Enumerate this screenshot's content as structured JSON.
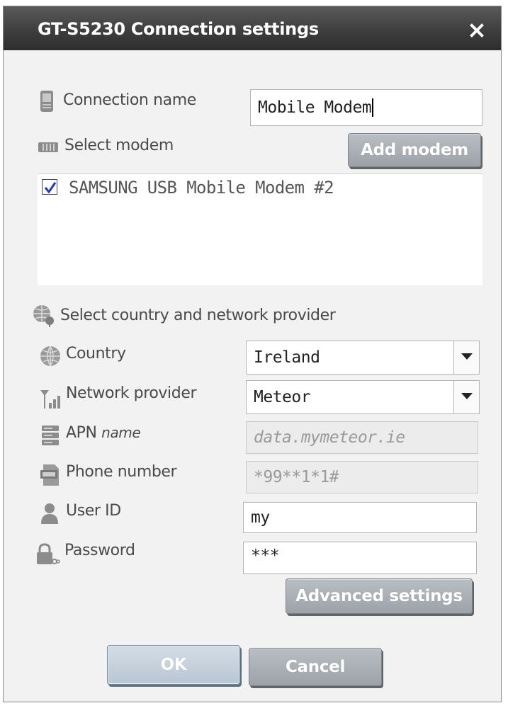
{
  "dialog": {
    "title": "GT-S5230 Connection settings",
    "close_label": "×"
  },
  "connection": {
    "name_label": "Connection name",
    "name_value": "Mobile Modem"
  },
  "modem": {
    "select_label": "Select modem",
    "add_button": "Add modem",
    "items": [
      {
        "label": "SAMSUNG USB Mobile Modem #2",
        "checked": true
      }
    ]
  },
  "network": {
    "section_label": "Select country and network provider",
    "country_label": "Country",
    "country_value": "Ireland",
    "provider_label": "Network provider",
    "provider_value": "Meteor",
    "apn_label_main": "APN",
    "apn_label_sub": "name",
    "apn_value": "data.mymeteor.ie",
    "phone_label": "Phone number",
    "phone_value": "*99**1*1#",
    "userid_label": "User ID",
    "userid_value": "my",
    "password_label": "Password",
    "password_value": "***"
  },
  "buttons": {
    "advanced": "Advanced settings",
    "ok": "OK",
    "cancel": "Cancel"
  },
  "colors": {
    "titlebar": "#3c3c3c",
    "dialog_bg": "#f2f2f2",
    "button": "#a9afb4"
  },
  "icons": [
    "phone-icon",
    "modem-icon",
    "globe-network-icon",
    "globe-icon",
    "signal-icon",
    "server-icon",
    "sim-card-icon",
    "user-icon",
    "lock-icon",
    "checkmark-icon",
    "chevron-down-icon",
    "close-icon"
  ]
}
